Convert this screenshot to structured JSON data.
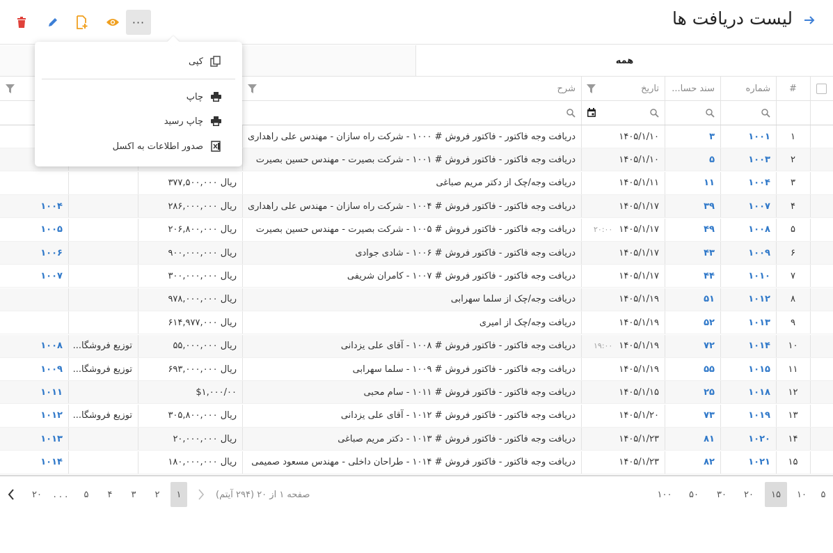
{
  "header": {
    "title": "لیست دریافت ها",
    "more_label": "···"
  },
  "tabs": [
    {
      "label": "همه"
    }
  ],
  "menu": {
    "items": [
      {
        "label": "کپی",
        "icon": "copy-icon"
      },
      {
        "label": "چاپ",
        "icon": "print-icon"
      },
      {
        "label": "چاپ رسید",
        "icon": "print-icon"
      },
      {
        "label": "صدور اطلاعات به اکسل",
        "icon": "excel-icon"
      }
    ]
  },
  "table": {
    "columns": {
      "index": "#",
      "number": "شماره",
      "doc": "سند حسا...",
      "date": "تاریخ",
      "description": "شرح"
    },
    "rows": [
      {
        "idx": "۱",
        "no": "۱۰۰۱",
        "doc": "۳",
        "date": "۱۴۰۵/۱/۱۰",
        "time": "",
        "desc": "دریافت وجه فاکتور - فاکتور فروش # ۱۰۰۰ - شرکت راه سازان - مهندس علی راهداری",
        "amount": "",
        "dist": "",
        "ref": ""
      },
      {
        "idx": "۲",
        "no": "۱۰۰۳",
        "doc": "۵",
        "date": "۱۴۰۵/۱/۱۰",
        "time": "",
        "desc": "دریافت وجه فاکتور - فاکتور فروش # ۱۰۰۱ - شرکت بصیرت - مهندس حسین بصیرت",
        "amount": "",
        "dist": "",
        "ref": ""
      },
      {
        "idx": "۳",
        "no": "۱۰۰۴",
        "doc": "۱۱",
        "date": "۱۴۰۵/۱/۱۱",
        "time": "",
        "desc": "دریافت وجه/چک از دکتر مریم صباغی",
        "amount": "ریال ۳۷۷,۵۰۰,۰۰۰",
        "dist": "",
        "ref": ""
      },
      {
        "idx": "۴",
        "no": "۱۰۰۷",
        "doc": "۳۹",
        "date": "۱۴۰۵/۱/۱۷",
        "time": "",
        "desc": "دریافت وجه فاکتور - فاکتور فروش # ۱۰۰۴ - شرکت راه سازان - مهندس علی راهداری",
        "amount": "ریال ۲۸۶,۰۰۰,۰۰۰",
        "dist": "",
        "ref": "۱۰۰۴"
      },
      {
        "idx": "۵",
        "no": "۱۰۰۸",
        "doc": "۴۹",
        "date": "۱۴۰۵/۱/۱۷",
        "time": "۲۰:۰۰",
        "desc": "دریافت وجه فاکتور - فاکتور فروش # ۱۰۰۵ - شرکت بصیرت - مهندس حسین بصیرت",
        "amount": "ریال ۲۰۶,۸۰۰,۰۰۰",
        "dist": "",
        "ref": "۱۰۰۵"
      },
      {
        "idx": "۶",
        "no": "۱۰۰۹",
        "doc": "۴۳",
        "date": "۱۴۰۵/۱/۱۷",
        "time": "",
        "desc": "دریافت وجه فاکتور - فاکتور فروش # ۱۰۰۶ - شادی جوادی",
        "amount": "ریال ۹۰۰,۰۰۰,۰۰۰",
        "dist": "",
        "ref": "۱۰۰۶"
      },
      {
        "idx": "۷",
        "no": "۱۰۱۰",
        "doc": "۴۴",
        "date": "۱۴۰۵/۱/۱۷",
        "time": "",
        "desc": "دریافت وجه فاکتور - فاکتور فروش # ۱۰۰۷ - کامران شریفی",
        "amount": "ریال ۳۰۰,۰۰۰,۰۰۰",
        "dist": "",
        "ref": "۱۰۰۷"
      },
      {
        "idx": "۸",
        "no": "۱۰۱۲",
        "doc": "۵۱",
        "date": "۱۴۰۵/۱/۱۹",
        "time": "",
        "desc": "دریافت وجه/چک از سلما سهرابی",
        "amount": "ریال ۹۷۸,۰۰۰,۰۰۰",
        "dist": "",
        "ref": ""
      },
      {
        "idx": "۹",
        "no": "۱۰۱۳",
        "doc": "۵۲",
        "date": "۱۴۰۵/۱/۱۹",
        "time": "",
        "desc": "دریافت وجه/چک از امیری",
        "amount": "ریال ۶۱۴,۹۷۷,۰۰۰",
        "dist": "",
        "ref": ""
      },
      {
        "idx": "۱۰",
        "no": "۱۰۱۴",
        "doc": "۷۲",
        "date": "۱۴۰۵/۱/۱۹",
        "time": "۱۹:۰۰",
        "desc": "دریافت وجه فاکتور - فاکتور فروش # ۱۰۰۸ - آقای علی یزدانی",
        "amount": "ریال ۵۵,۰۰۰,۰۰۰",
        "dist": "توزیع فروشگا...",
        "ref": "۱۰۰۸"
      },
      {
        "idx": "۱۱",
        "no": "۱۰۱۵",
        "doc": "۵۵",
        "date": "۱۴۰۵/۱/۱۹",
        "time": "",
        "desc": "دریافت وجه فاکتور - فاکتور فروش # ۱۰۰۹ - سلما سهرابی",
        "amount": "ریال ۶۹۳,۰۰۰,۰۰۰",
        "dist": "توزیع فروشگا...",
        "ref": "۱۰۰۹"
      },
      {
        "idx": "۱۲",
        "no": "۱۰۱۸",
        "doc": "۲۵",
        "date": "۱۴۰۵/۱/۱۵",
        "time": "",
        "desc": "دریافت وجه فاکتور - فاکتور فروش # ۱۰۱۱ - سام محبی",
        "amount": "$۱,۰۰۰/۰۰",
        "dist": "",
        "ref": "۱۰۱۱"
      },
      {
        "idx": "۱۳",
        "no": "۱۰۱۹",
        "doc": "۷۳",
        "date": "۱۴۰۵/۱/۲۰",
        "time": "",
        "desc": "دریافت وجه فاکتور - فاکتور فروش # ۱۰۱۲ - آقای علی یزدانی",
        "amount": "ریال ۳۰۵,۸۰۰,۰۰۰",
        "dist": "توزیع فروشگا...",
        "ref": "۱۰۱۲"
      },
      {
        "idx": "۱۴",
        "no": "۱۰۲۰",
        "doc": "۸۱",
        "date": "۱۴۰۵/۱/۲۳",
        "time": "",
        "desc": "دریافت وجه فاکتور - فاکتور فروش # ۱۰۱۳ - دکتر مریم صباغی",
        "amount": "ریال ۲۰,۰۰۰,۰۰۰",
        "dist": "",
        "ref": "۱۰۱۳"
      },
      {
        "idx": "۱۵",
        "no": "۱۰۲۱",
        "doc": "۸۲",
        "date": "۱۴۰۵/۱/۲۳",
        "time": "",
        "desc": "دریافت وجه فاکتور - فاکتور فروش # ۱۰۱۴ - طراحان داخلی - مهندس مسعود صمیمی",
        "amount": "ریال ۱۸۰,۰۰۰,۰۰۰",
        "dist": "",
        "ref": "۱۰۱۴"
      }
    ]
  },
  "pager": {
    "info": "صفحه ۱ از ۲۰ (۲۹۴ آیتم)",
    "pages": [
      "۱",
      "۲",
      "۳",
      "۴",
      "۵",
      ". . .",
      "۲۰"
    ],
    "current_page": "۱",
    "page_sizes": [
      "۵",
      "۱۰",
      "۱۵",
      "۲۰",
      "۳۰",
      "۵۰",
      "۱۰۰"
    ],
    "current_page_size": "۱۵"
  },
  "colors": {
    "accent": "#2f78c9",
    "delete": "#e0413a",
    "edit": "#3d7fd6",
    "add_doc": "#f0a020",
    "view": "#f0a020"
  }
}
